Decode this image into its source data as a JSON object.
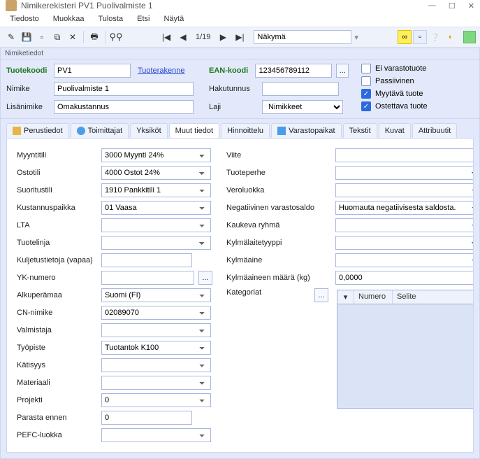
{
  "titlebar": {
    "title": "Nimikerekisteri PV1 Puolivalmiste 1"
  },
  "menubar": {
    "file": "Tiedosto",
    "edit": "Muokkaa",
    "print": "Tulosta",
    "search": "Etsi",
    "view": "Näytä"
  },
  "nav": {
    "position": "1/19",
    "view_label": "Näkymä"
  },
  "section": {
    "label": "Nimiketiedot"
  },
  "id": {
    "tuotekoodi_lbl": "Tuotekoodi",
    "tuotekoodi": "PV1",
    "tuoterakenne": "Tuoterakenne",
    "nimike_lbl": "Nimike",
    "nimike": "Puolivalmiste 1",
    "lisanimike_lbl": "Lisänimike",
    "lisanimike": "Omakustannus",
    "ean_lbl": "EAN-koodi",
    "ean": "123456789112",
    "hakutunnus_lbl": "Hakutunnus",
    "hakutunnus": "",
    "laji_lbl": "Laji",
    "laji": "Nimikkeet"
  },
  "flags": {
    "ei_varasto": "Ei varastotuote",
    "passiivinen": "Passiivinen",
    "myytava": "Myytävä tuote",
    "ostettava": "Ostettava tuote"
  },
  "tabs": {
    "perustiedot": "Perustiedot",
    "toimittajat": "Toimittajat",
    "yksikot": "Yksiköt",
    "muut": "Muut tiedot",
    "hinnoittelu": "Hinnoittelu",
    "varastopaikat": "Varastopaikat",
    "tekstit": "Tekstit",
    "kuvat": "Kuvat",
    "attribuutit": "Attribuutit"
  },
  "left": {
    "myyntitili_l": "Myyntitili",
    "myyntitili": "3000 Myynti 24%",
    "ostotili_l": "Ostotili",
    "ostotili": "4000 Ostot 24%",
    "suoritustili_l": "Suoritustili",
    "suoritustili": "1910 Pankkitili 1",
    "kustannuspaikka_l": "Kustannuspaikka",
    "kustannuspaikka": "01 Vaasa",
    "lta_l": "LTA",
    "lta": "",
    "tuotelinja_l": "Tuotelinja",
    "tuotelinja": "",
    "kuljetus_l": "Kuljetustietoja (vapaa)",
    "kuljetus": "",
    "yk_l": "YK-numero",
    "yk": "",
    "alku_l": "Alkuperämaa",
    "alku": "Suomi (FI)",
    "cn_l": "CN-nimike",
    "cn": "02089070",
    "valmistaja_l": "Valmistaja",
    "valmistaja": "",
    "tyopiste_l": "Työpiste",
    "tyopiste": "Tuotantok K100",
    "katisyys_l": "Kätisyys",
    "katisyys": "",
    "materiaali_l": "Materiaali",
    "materiaali": "",
    "projekti_l": "Projekti",
    "projekti": "0",
    "parasta_l": "Parasta ennen",
    "parasta": "0",
    "pefc_l": "PEFC-luokka",
    "pefc": ""
  },
  "right": {
    "viite_l": "Viite",
    "viite": "",
    "tuoteperhe_l": "Tuoteperhe",
    "tuoteperhe": "",
    "veroluokka_l": "Veroluokka",
    "veroluokka": "",
    "neg_l": "Negatiivinen varastosaldo",
    "neg": "Huomauta negatiivisesta saldosta.",
    "kaukeva_l": "Kaukeva ryhmä",
    "kaukeva": "",
    "kylmatyyppi_l": "Kylmälaitetyyppi",
    "kylmatyyppi": "",
    "kylmaaine_l": "Kylmäaine",
    "kylmaaine": "",
    "kylmamaara_l": "Kylmäaineen määrä (kg)",
    "kylmamaara": "0,0000",
    "kategoriat_l": "Kategoriat",
    "cat_numero": "Numero",
    "cat_selite": "Selite"
  }
}
